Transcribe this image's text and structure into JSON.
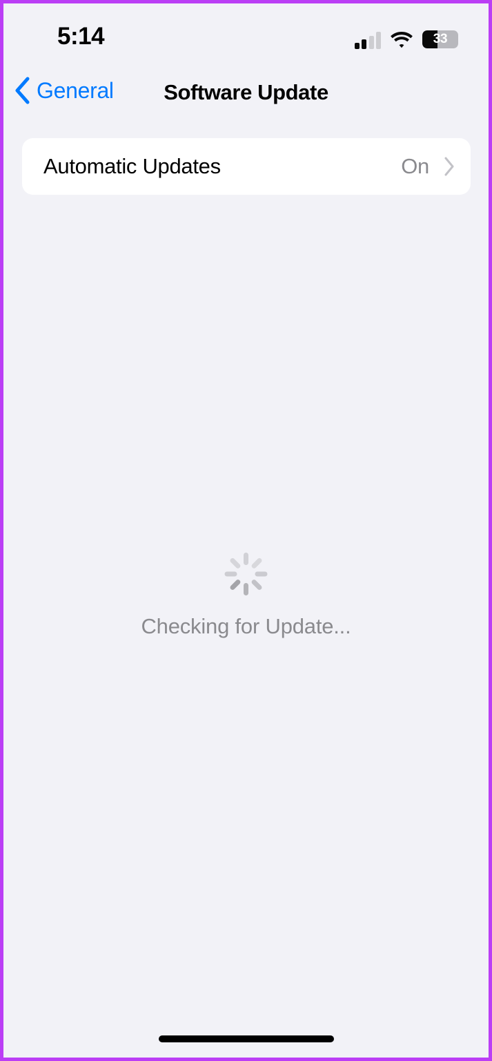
{
  "status_bar": {
    "time": "5:14",
    "cellular_icon": "cellular-signal-icon",
    "cellular_bars_active": 2,
    "cellular_bars_total": 4,
    "wifi_icon": "wifi-icon",
    "wifi_strength": "full",
    "battery_icon": "battery-icon",
    "battery_percent": "33",
    "battery_fill_ratio": 0.42
  },
  "nav_bar": {
    "back_icon": "chevron-left-icon",
    "back_label": "General",
    "title": "Software Update"
  },
  "settings": {
    "rows": [
      {
        "label": "Automatic Updates",
        "value": "On",
        "disclosure_icon": "chevron-right-icon"
      }
    ]
  },
  "status_content": {
    "spinner_icon": "activity-indicator-spinner",
    "message": "Checking for Update..."
  },
  "home_indicator": {
    "icon": "home-indicator-bar"
  },
  "colors": {
    "accent_blue": "#007aff",
    "grouped_background": "#f2f2f7",
    "card_background": "#ffffff",
    "secondary_label": "#8a8a8e",
    "primary_label": "#000000",
    "annotation_border": "#bb3ef5"
  }
}
